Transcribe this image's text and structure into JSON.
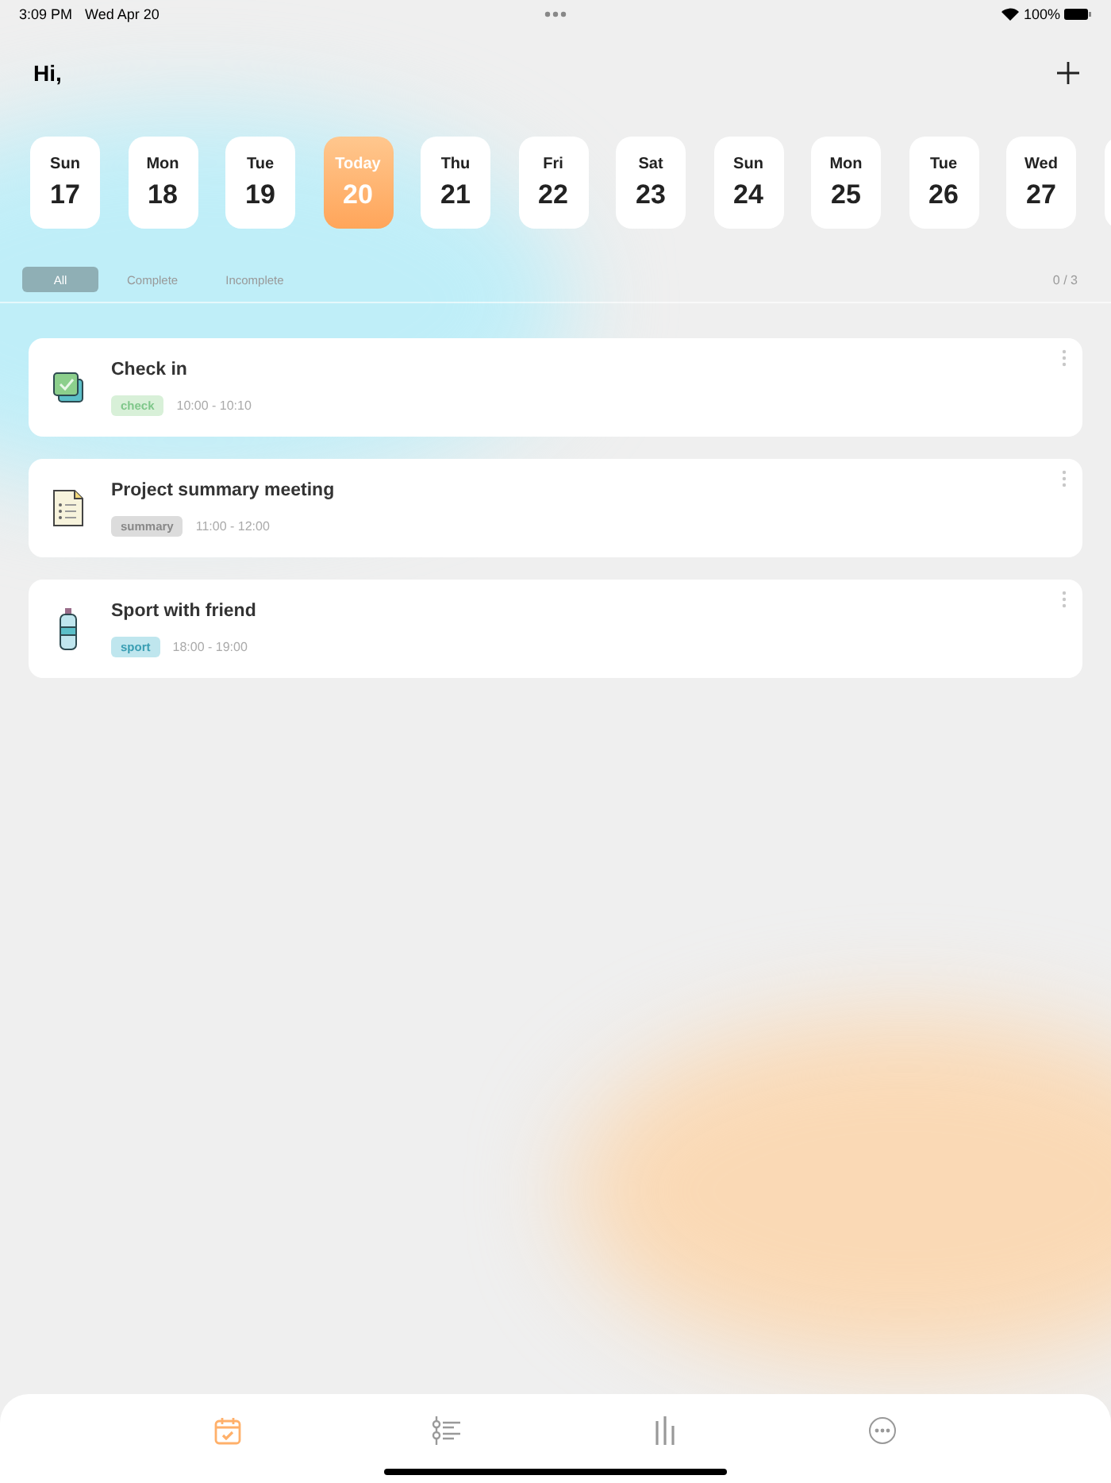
{
  "status_bar": {
    "time": "3:09 PM",
    "date": "Wed Apr 20",
    "battery": "100%"
  },
  "header": {
    "greeting": "Hi,"
  },
  "days": [
    {
      "weekday": "Sun",
      "day": "17",
      "selected": false
    },
    {
      "weekday": "Mon",
      "day": "18",
      "selected": false
    },
    {
      "weekday": "Tue",
      "day": "19",
      "selected": false
    },
    {
      "weekday": "Today",
      "day": "20",
      "selected": true
    },
    {
      "weekday": "Thu",
      "day": "21",
      "selected": false
    },
    {
      "weekday": "Fri",
      "day": "22",
      "selected": false
    },
    {
      "weekday": "Sat",
      "day": "23",
      "selected": false
    },
    {
      "weekday": "Sun",
      "day": "24",
      "selected": false
    },
    {
      "weekday": "Mon",
      "day": "25",
      "selected": false
    },
    {
      "weekday": "Tue",
      "day": "26",
      "selected": false
    },
    {
      "weekday": "Wed",
      "day": "27",
      "selected": false
    }
  ],
  "filters": [
    {
      "label": "All",
      "selected": true
    },
    {
      "label": "Complete",
      "selected": false
    },
    {
      "label": "Incomplete",
      "selected": false
    }
  ],
  "progress": "0 / 3",
  "tasks": [
    {
      "kind": "check",
      "title": "Check in",
      "tag": "check",
      "color": "#d8f0d8",
      "time": "10:00 - 10:10"
    },
    {
      "kind": "document",
      "title": "Project summary meeting",
      "tag": "summary",
      "color": "#dcdcdc",
      "time": "11:00 - 12:00"
    },
    {
      "kind": "bottle",
      "title": "Sport with friend",
      "tag": "sport",
      "color": "#bfe6ee",
      "time": "18:00 - 19:00"
    }
  ],
  "tab_bar": [
    {
      "kind": "calendar",
      "selected": true
    },
    {
      "kind": "list",
      "selected": false
    },
    {
      "kind": "stats",
      "selected": false
    },
    {
      "kind": "more",
      "selected": false
    }
  ]
}
